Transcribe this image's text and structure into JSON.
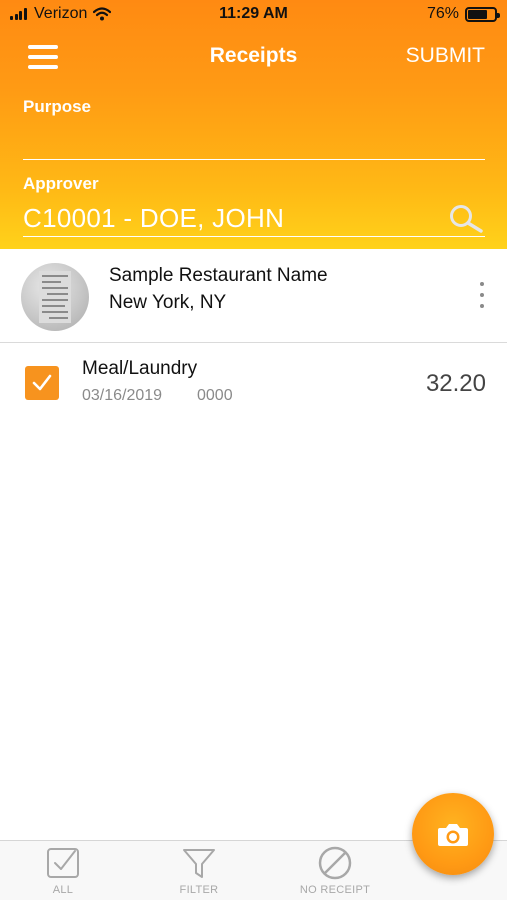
{
  "status_bar": {
    "carrier": "Verizon",
    "time": "11:29 AM",
    "battery_percent": "76%",
    "battery_level": 0.76
  },
  "nav": {
    "title": "Receipts",
    "submit_label": "SUBMIT",
    "menu_icon": "hamburger-menu-icon"
  },
  "form": {
    "purpose_label": "Purpose",
    "purpose_value": "",
    "approver_label": "Approver",
    "approver_value": "C10001 - DOE, JOHN",
    "search_icon": "search-icon"
  },
  "receipt": {
    "name": "Sample Restaurant Name",
    "location": "New York, NY",
    "thumbnail_icon": "receipt-thumbnail",
    "more_icon": "more-vertical-icon"
  },
  "expenses": [
    {
      "title": "Meal/Laundry",
      "date": "03/16/2019",
      "code": "0000",
      "amount": "32.20",
      "checked": true
    }
  ],
  "tabs": [
    {
      "label": "ALL",
      "icon": "checkbox-icon"
    },
    {
      "label": "FILTER",
      "icon": "filter-icon"
    },
    {
      "label": "NO RECEIPT",
      "icon": "no-receipt-icon"
    }
  ],
  "fab": {
    "icon": "camera-icon"
  },
  "colors": {
    "accent": "#f7931e",
    "header_top": "#ff8a12",
    "header_bottom": "#ffd21a"
  }
}
